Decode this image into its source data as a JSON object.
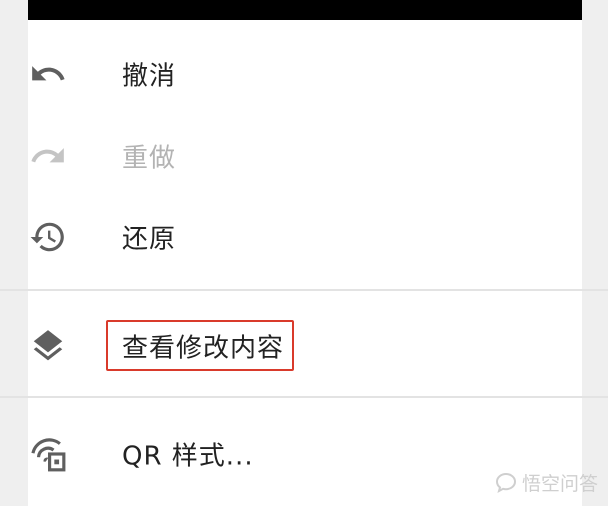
{
  "menu": {
    "items": [
      {
        "label": "撤消",
        "icon": "undo-icon",
        "enabled": true
      },
      {
        "label": "重做",
        "icon": "redo-icon",
        "enabled": false
      },
      {
        "label": "还原",
        "icon": "history-restore-icon",
        "enabled": true
      },
      {
        "label": "查看修改内容",
        "icon": "layers-icon",
        "enabled": true,
        "highlighted": true
      },
      {
        "label": "QR 样式...",
        "icon": "qr-wifi-icon",
        "enabled": true
      }
    ]
  },
  "watermark": {
    "text": "悟空问答"
  },
  "colors": {
    "highlight": "#d93a2b",
    "text": "#222222",
    "disabled": "#b3b3b3",
    "icon": "#5f5f5f"
  }
}
